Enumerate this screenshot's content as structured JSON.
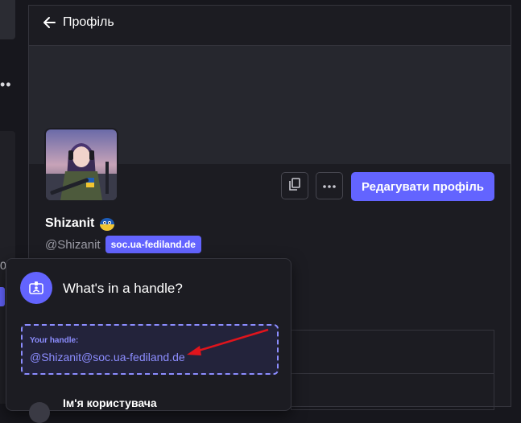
{
  "header": {
    "title": "Профіль"
  },
  "sidebar": {
    "counter_digit": "0"
  },
  "profile": {
    "display_name": "Shizanit",
    "handle": "@Shizanit",
    "domain": "soc.ua-fediland.de",
    "edit_button": "Редагувати профіль",
    "avatar_icon": "avatar-anime-girl",
    "emoji_icon": "ua-flag-blob-emoji",
    "copy_icon": "copy-icon",
    "more_icon": "more-horizontal-icon"
  },
  "popover": {
    "icon": "id-card-icon",
    "title": "What's in a handle?",
    "handle_label": "Your handle:",
    "handle_value": "@Shizanit@soc.ua-fediland.de",
    "username_label": "Ім'я користувача"
  },
  "colors": {
    "accent": "#6364ff",
    "accent_light": "#8c8dff",
    "background": "#17171d",
    "annotation_arrow": "#e0141c"
  }
}
